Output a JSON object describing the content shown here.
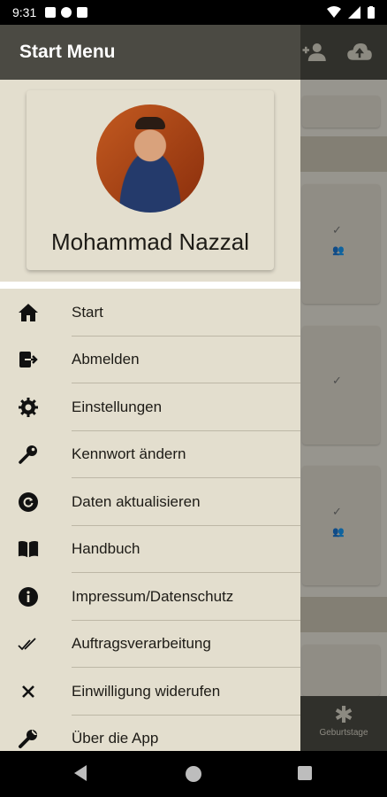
{
  "status_bar": {
    "time": "9:31"
  },
  "drawer": {
    "title": "Start Menu",
    "profile_name": "Mohammad Nazzal",
    "menu_items": [
      {
        "label": "Start",
        "icon": "home-icon"
      },
      {
        "label": "Abmelden",
        "icon": "logout-icon"
      },
      {
        "label": "Einstellungen",
        "icon": "gear-icon"
      },
      {
        "label": "Kennwort ändern",
        "icon": "key-icon"
      },
      {
        "label": "Daten aktualisieren",
        "icon": "refresh-icon"
      },
      {
        "label": "Handbuch",
        "icon": "book-icon"
      },
      {
        "label": "Impressum/Datenschutz",
        "icon": "info-icon"
      },
      {
        "label": "Auftragsverarbeitung",
        "icon": "double-check-icon"
      },
      {
        "label": "Einwilligung widerufen",
        "icon": "close-icon"
      },
      {
        "label": "Über die App",
        "icon": "wrench-icon"
      }
    ]
  },
  "background": {
    "bottom_nav_label": "Geburtstage"
  }
}
